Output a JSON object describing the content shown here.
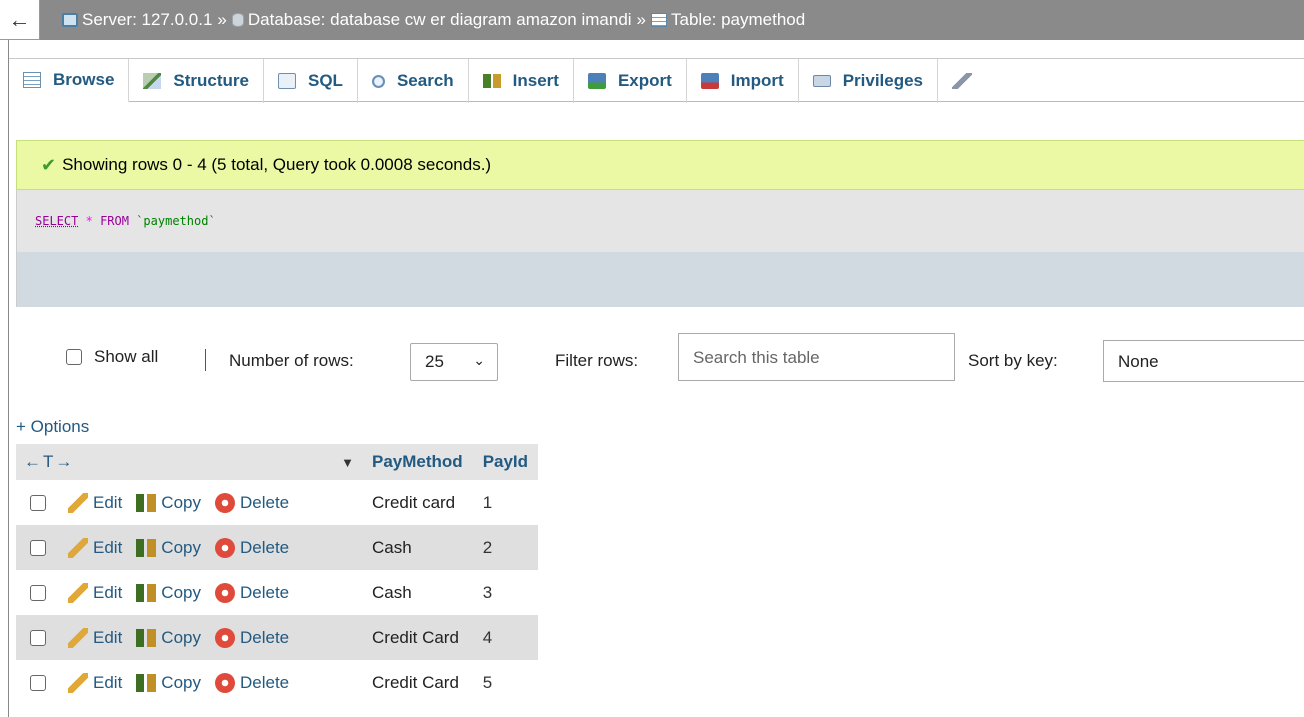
{
  "breadcrumb": {
    "back_glyph": "←",
    "server": "Server: 127.0.0.1",
    "database": "Database: database cw er diagram amazon imandi",
    "table": "Table: paymethod",
    "separator": "»"
  },
  "tabs": [
    {
      "label": "Browse",
      "icon": "browse-icon"
    },
    {
      "label": "Structure",
      "icon": "structure-icon"
    },
    {
      "label": "SQL",
      "icon": "sql-icon"
    },
    {
      "label": "Search",
      "icon": "search-icon"
    },
    {
      "label": "Insert",
      "icon": "insert-icon"
    },
    {
      "label": "Export",
      "icon": "export-icon"
    },
    {
      "label": "Import",
      "icon": "import-icon"
    },
    {
      "label": "Privileges",
      "icon": "privileges-icon"
    }
  ],
  "message": {
    "text": "Showing rows 0 - 4 (5 total, Query took 0.0008 seconds.)",
    "check_glyph": "✔"
  },
  "query": {
    "select": "SELECT",
    "star": "*",
    "from": "FROM",
    "table": "`paymethod`"
  },
  "controls": {
    "show_all": "Show all",
    "separator": "|",
    "number_of_rows_label": "Number of rows:",
    "number_of_rows_value": "25",
    "filter_label": "Filter rows:",
    "filter_placeholder": "Search this table",
    "sort_label": "Sort by key:",
    "sort_value": "None"
  },
  "options_link": "+ Options",
  "table": {
    "arrows": "←T→",
    "sort_glyph": "▼",
    "columns": [
      "PayMethod",
      "PayId"
    ],
    "actions": {
      "edit": "Edit",
      "copy": "Copy",
      "delete": "Delete"
    },
    "rows": [
      {
        "paymethod": "Credit card",
        "payid": "1"
      },
      {
        "paymethod": "Cash",
        "payid": "2"
      },
      {
        "paymethod": "Cash",
        "payid": "3"
      },
      {
        "paymethod": "Credit Card",
        "payid": "4"
      },
      {
        "paymethod": "Credit Card",
        "payid": "5"
      }
    ]
  },
  "colors": {
    "topbar": "#8a8a8a",
    "link": "#235a81",
    "success_bg": "#ebf8a4",
    "row_alt": "#dfdfdf"
  }
}
